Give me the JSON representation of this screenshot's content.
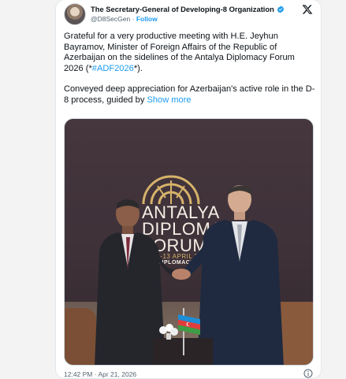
{
  "author": {
    "name": "The Secretary-General of Developing-8 Organization",
    "handle": "@D8SecGen",
    "separator": "·",
    "follow_label": "Follow"
  },
  "tweet": {
    "p1_text": "Grateful for a very productive meeting with H.E. Jeyhun Bayramov, Minister of Foreign Affairs of the Republic of Azerbaijan on the sidelines of the Antalya Diplomacy Forum 2026 (*",
    "p1_hashtag": "#ADF2026",
    "p1_end": "*).",
    "p2_text": "Conveyed deep appreciation for Azerbaijan's active role in the D-8 process, guided by ",
    "show_more": "Show more"
  },
  "photo": {
    "banner_line1": "ANTALYA",
    "banner_line2": "DIPLOMACY",
    "banner_line3": "FORUM",
    "banner_line4": "11-13 APRIL 2026",
    "banner_line5": "DIPLOMACY"
  },
  "footer": {
    "timestamp": "12:42 PM · Apr 21, 2026"
  },
  "icons": {
    "verified": "verified-badge-icon",
    "x_logo": "x-logo-icon",
    "info": "info-icon"
  },
  "colors": {
    "link": "#1d9bf0",
    "verified": "#1d9bf0",
    "banner_gold": "#d6b36a"
  }
}
